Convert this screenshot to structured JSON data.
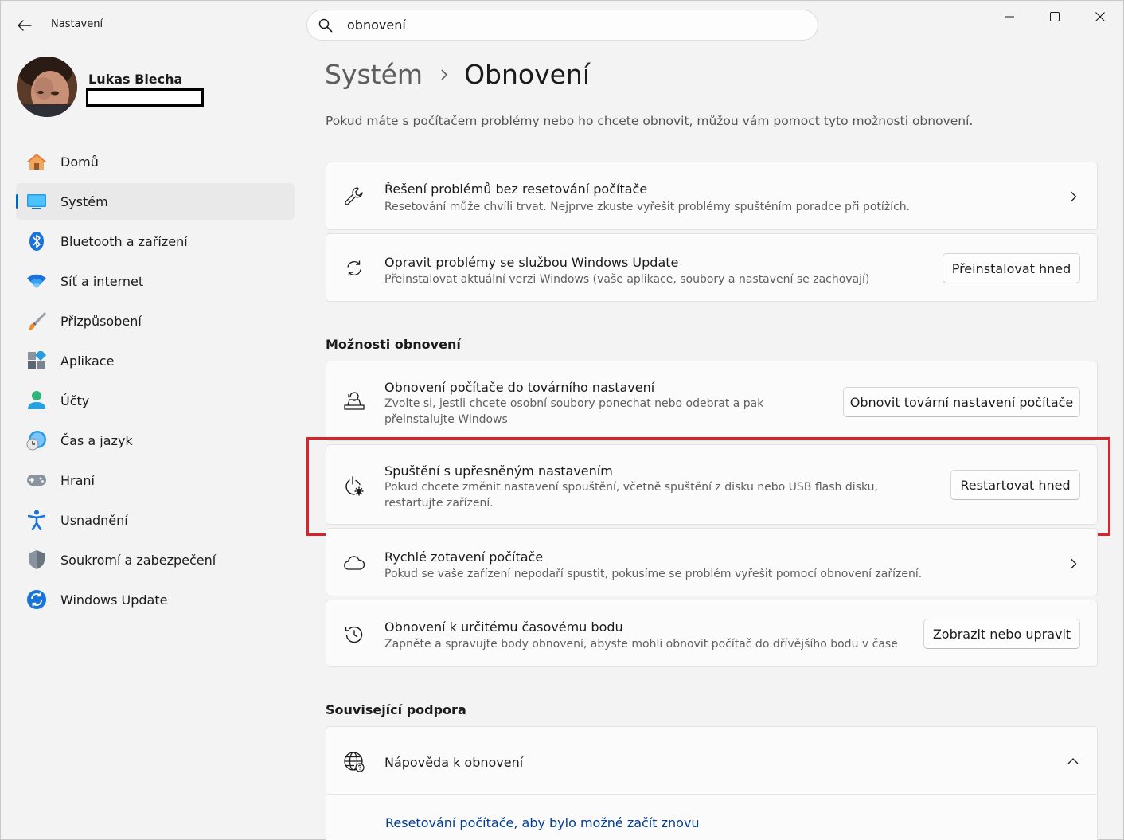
{
  "window": {
    "app_title": "Nastavení",
    "minimize_icon": "minimize-icon",
    "maximize_icon": "maximize-icon",
    "close_icon": "close-icon"
  },
  "search": {
    "value": "obnovení",
    "icon": "search-icon"
  },
  "profile": {
    "name": "Lukas Blecha"
  },
  "sidebar": {
    "items": [
      {
        "label": "Domů",
        "icon": "home-icon"
      },
      {
        "label": "Systém",
        "icon": "monitor-icon",
        "selected": true
      },
      {
        "label": "Bluetooth a zařízení",
        "icon": "bluetooth-icon"
      },
      {
        "label": "Síť a internet",
        "icon": "wifi-icon"
      },
      {
        "label": "Přizpůsobení",
        "icon": "paintbrush-icon"
      },
      {
        "label": "Aplikace",
        "icon": "apps-icon"
      },
      {
        "label": "Účty",
        "icon": "person-icon"
      },
      {
        "label": "Čas a jazyk",
        "icon": "clock-globe-icon"
      },
      {
        "label": "Hraní",
        "icon": "gamepad-icon"
      },
      {
        "label": "Usnadnění",
        "icon": "accessibility-icon"
      },
      {
        "label": "Soukromí a zabezpečení",
        "icon": "shield-icon"
      },
      {
        "label": "Windows Update",
        "icon": "update-icon"
      }
    ]
  },
  "header": {
    "parent": "Systém",
    "current": "Obnovení",
    "intro": "Pokud máte s počítačem problémy nebo ho chcete obnovit, můžou vám pomoct tyto možnosti obnovení."
  },
  "cards_top": [
    {
      "title": "Řešení problémů bez resetování počítače",
      "desc": "Resetování může chvíli trvat. Nejprve zkuste vyřešit problémy spuštěním poradce při potížích.",
      "icon": "wrench-icon"
    },
    {
      "title": "Opravit problémy se službou Windows Update",
      "desc": "Přeinstalovat aktuální verzi Windows (vaše aplikace, soubory a nastavení se zachovají)",
      "button": "Přeinstalovat hned",
      "icon": "refresh-icon"
    }
  ],
  "recovery_section": {
    "title": "Možnosti obnovení",
    "items": [
      {
        "title": "Obnovení počítače do továrního nastavení",
        "desc": "Zvolte si, jestli chcete osobní soubory ponechat nebo odebrat a pak přeinstalujte Windows",
        "button": "Obnovit tovární nastavení počítače",
        "icon": "reset-pc-icon"
      },
      {
        "title": "Spuštění s upřesněným nastavením",
        "desc": "Pokud chcete změnit nastavení spouštění, včetně spuštění z disku nebo USB flash disku, restartujte zařízení.",
        "button": "Restartovat hned",
        "icon": "advanced-startup-icon"
      },
      {
        "title": "Rychlé zotavení počítače",
        "desc": "Pokud se vaše zařízení nepodaří spustit, pokusíme se problém vyřešit pomocí obnovení zařízení.",
        "icon": "cloud-icon"
      },
      {
        "title": "Obnovení k určitému časovému bodu",
        "desc": "Zapněte a spravujte body obnovení, abyste mohli obnovit počítač do dřívějšího bodu v čase",
        "button": "Zobrazit nebo upravit",
        "icon": "history-icon"
      }
    ]
  },
  "support": {
    "title": "Související podpora",
    "help_title": "Nápověda k obnovení",
    "help_link": "Resetování počítače, aby bylo možné začít znovu",
    "icon": "globe-help-icon"
  },
  "colors": {
    "accent": "#0067c0",
    "highlight": "#d8232a",
    "link": "#003e92"
  }
}
